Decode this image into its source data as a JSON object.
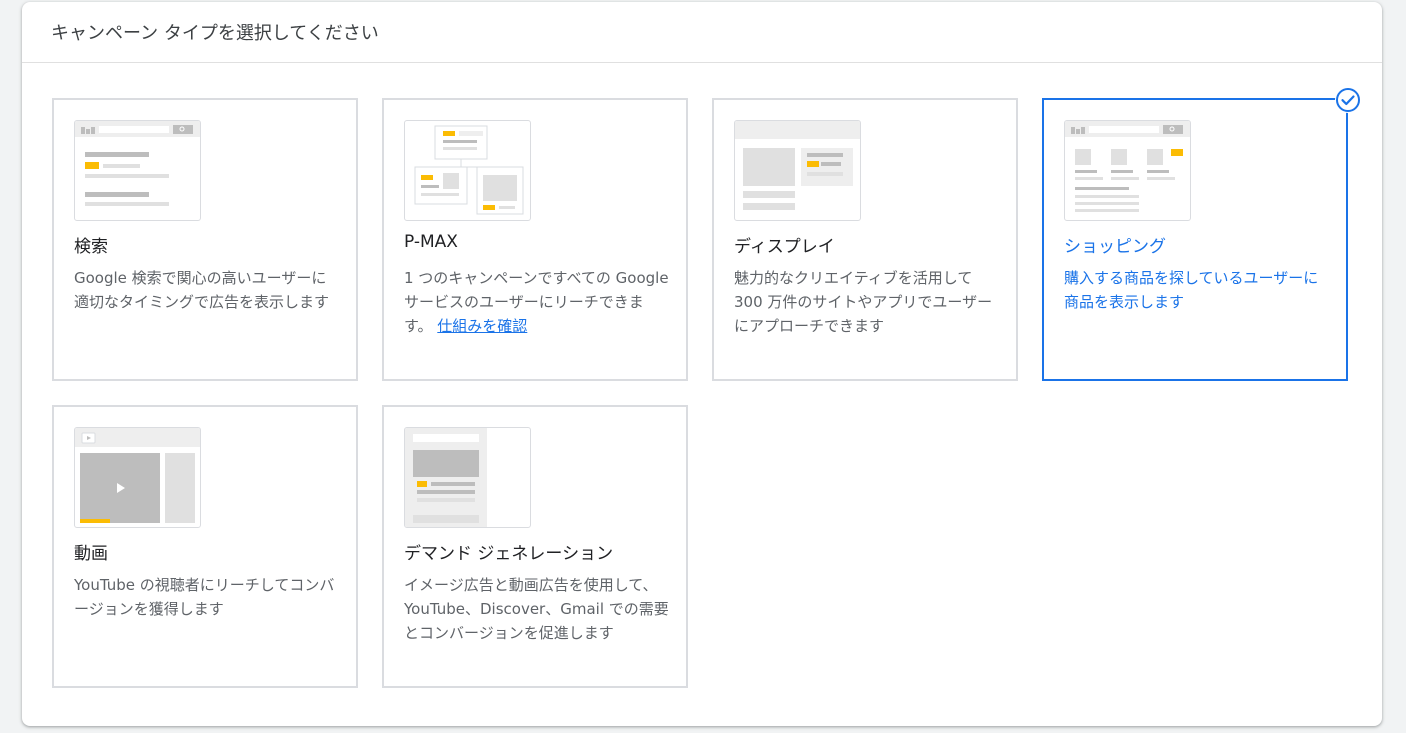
{
  "header": {
    "title": "キャンペーン タイプを選択してください"
  },
  "cards": [
    {
      "title": "検索",
      "description": "Google 検索で関心の高いユーザーに適切なタイミングで広告を表示します",
      "illustration": "search-illustration",
      "selected": false
    },
    {
      "title": "P-MAX",
      "description": "1 つのキャンペーンですべての Google サービスのユーザーにリーチできます。",
      "link": "仕組みを確認",
      "illustration": "pmax-illustration",
      "selected": false
    },
    {
      "title": "ディスプレイ",
      "description": "魅力的なクリエイティブを活用して 300 万件のサイトやアプリでユーザーにアプローチできます",
      "illustration": "display-illustration",
      "selected": false
    },
    {
      "title": "ショッピング",
      "description": "購入する商品を探しているユーザーに商品を表示します",
      "illustration": "shopping-illustration",
      "selected": true
    },
    {
      "title": "動画",
      "description": "YouTube の視聴者にリーチしてコンバージョンを獲得します",
      "illustration": "video-illustration",
      "selected": false
    },
    {
      "title": "デマンド ジェネレーション",
      "description": "イメージ広告と動画広告を使用して、YouTube、Discover、Gmail での需要とコンバージョンを促進します",
      "illustration": "demand-gen-illustration",
      "selected": false
    }
  ],
  "colors": {
    "accent": "#1a73e8",
    "highlight": "#fbbc04",
    "border": "#dadce0",
    "placeholder": "#bdbdbd"
  },
  "icons": {
    "selected_indicator": "check-circle-icon"
  }
}
